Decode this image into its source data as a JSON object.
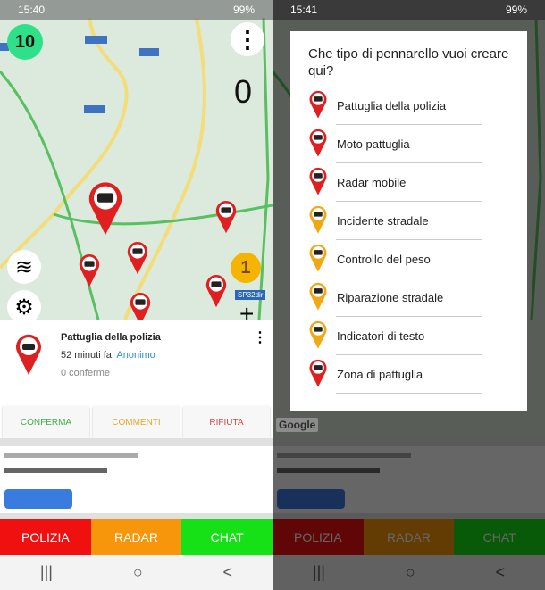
{
  "left": {
    "status": {
      "time": "15:40",
      "right": "99%"
    },
    "map": {
      "badge": "10",
      "counter": "0",
      "road_label": "SP32dir",
      "rank": "1"
    },
    "info": {
      "title": "Pattuglia della polizia",
      "time": "52 minuti fa,",
      "author": "Anonimo",
      "confirmations": "0 conferme"
    },
    "actions": [
      {
        "label": "CONFERMA",
        "color": "#3cae4a"
      },
      {
        "label": "COMMENTI",
        "color": "#e6a92a"
      },
      {
        "label": "RIFIUTA",
        "color": "#d94545"
      }
    ],
    "bottom": [
      {
        "label": "POLIZIA",
        "color": "#f01010"
      },
      {
        "label": "RADAR",
        "color": "#f7960a"
      },
      {
        "label": "CHAT",
        "color": "#16e016"
      }
    ]
  },
  "right": {
    "status": {
      "time": "15:41",
      "right": "99%"
    },
    "dialog": {
      "title": "Che tipo di pennarello vuoi creare qui?",
      "options": [
        {
          "label": "Pattuglia della polizia",
          "color": "#e02020",
          "icon": "police-car-icon"
        },
        {
          "label": "Moto pattuglia",
          "color": "#e02020",
          "icon": "motorcycle-icon"
        },
        {
          "label": "Radar mobile",
          "color": "#e02020",
          "icon": "radar-camera-icon"
        },
        {
          "label": "Incidente stradale",
          "color": "#f2a812",
          "icon": "car-crash-icon"
        },
        {
          "label": "Controllo del peso",
          "color": "#f2a812",
          "icon": "weight-icon"
        },
        {
          "label": "Riparazione stradale",
          "color": "#f2a812",
          "icon": "road-work-icon"
        },
        {
          "label": "Indicatori di testo",
          "color": "#f2a812",
          "icon": "speech-bubble-icon"
        },
        {
          "label": "Zona di pattuglia",
          "color": "#e02020",
          "icon": "police-car-icon"
        }
      ]
    },
    "bottom": [
      {
        "label": "POLIZIA"
      },
      {
        "label": "RADAR"
      },
      {
        "label": "CHAT"
      }
    ],
    "map_attribution": "Google"
  },
  "nav": {
    "recent": "|||",
    "home": "○",
    "back": "<"
  }
}
